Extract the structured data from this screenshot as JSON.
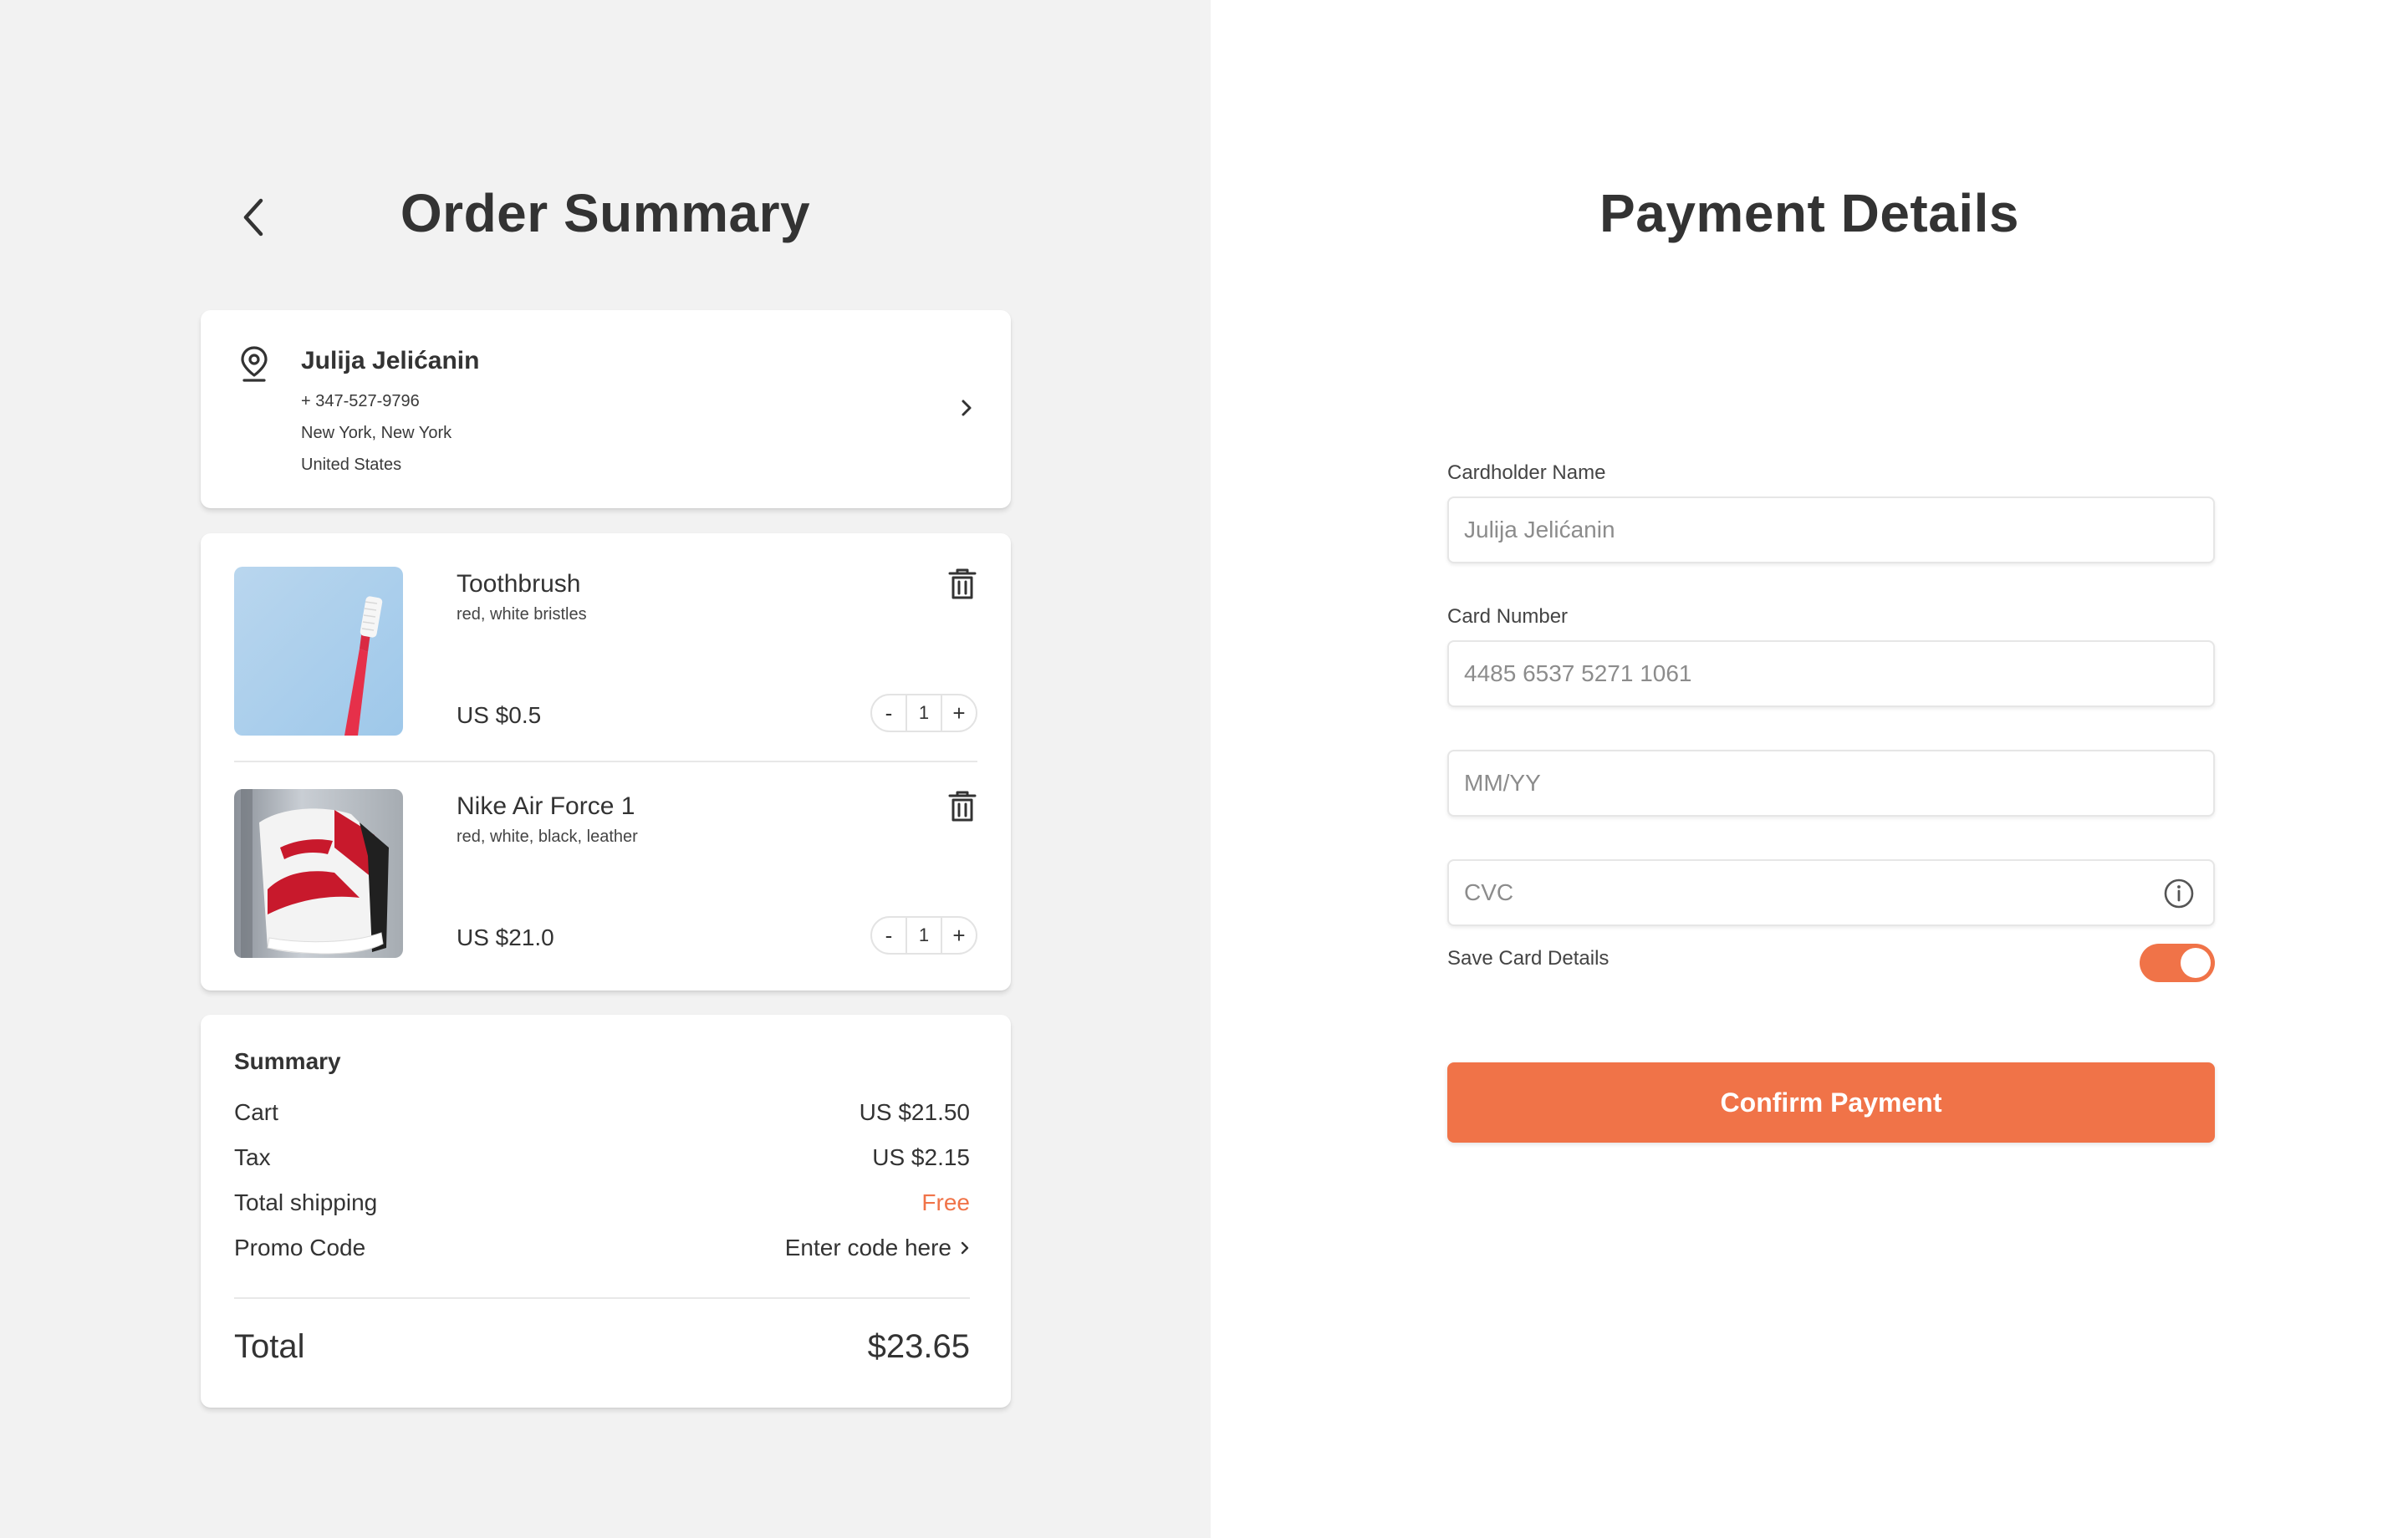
{
  "order_summary": {
    "title": "Order Summary",
    "address": {
      "name": "Julija Jelićanin",
      "phone": "+ 347-527-9796",
      "city": "New York, New York",
      "country": "United States"
    },
    "items": [
      {
        "name": "Toothbrush",
        "desc": "red, white bristles",
        "price": "US $0.5",
        "qty": "1",
        "minus": "-",
        "plus": "+"
      },
      {
        "name": "Nike Air Force 1",
        "desc": "red, white, black, leather",
        "price": "US $21.0",
        "qty": "1",
        "minus": "-",
        "plus": "+"
      }
    ],
    "summary": {
      "heading": "Summary",
      "cart_label": "Cart",
      "cart_value": "US $21.50",
      "tax_label": "Tax",
      "tax_value": "US $2.15",
      "shipping_label": "Total shipping",
      "shipping_value": "Free",
      "promo_label": "Promo Code",
      "promo_value": "Enter code here",
      "total_label": "Total",
      "total_value": "$23.65"
    }
  },
  "payment_details": {
    "title": "Payment Details",
    "cardholder_label": "Cardholder Name",
    "cardholder_placeholder": "Julija Jelićanin",
    "card_number_label": "Card Number",
    "card_number_placeholder": "4485 6537 5271 1061",
    "expiry_placeholder": "MM/YY",
    "cvc_placeholder": "CVC",
    "save_card_label": "Save Card Details",
    "save_card_enabled": true,
    "confirm_label": "Confirm Payment"
  },
  "colors": {
    "accent": "#f07348",
    "text": "#333333",
    "left_bg": "#f2f2f2",
    "right_bg": "#ffffff"
  },
  "icons": [
    "back-chevron-icon",
    "location-pin-icon",
    "chevron-right-icon",
    "trash-icon",
    "info-icon"
  ]
}
